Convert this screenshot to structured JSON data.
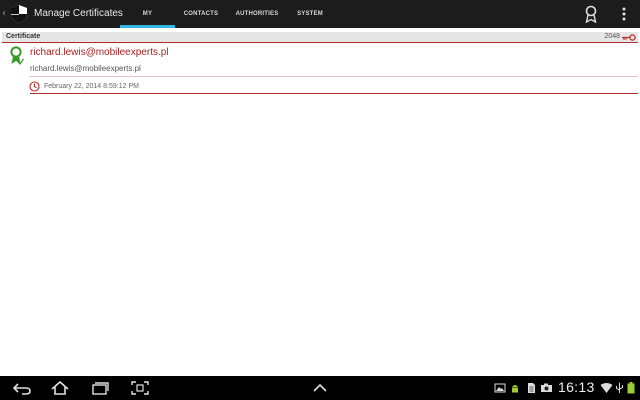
{
  "app": {
    "title": "Manage Certificates",
    "up_glyph": "‹",
    "icon": "shield-icon"
  },
  "tabs": [
    {
      "label": "MY",
      "active": true
    },
    {
      "label": "CONTACTS",
      "active": false
    },
    {
      "label": "AUTHORITIES",
      "active": false
    },
    {
      "label": "SYSTEM",
      "active": false
    }
  ],
  "actions": [
    {
      "icon": "award-icon"
    },
    {
      "icon": "overflow-menu-icon"
    }
  ],
  "section": {
    "label": "Certificate",
    "count": "2048",
    "icon": "key-icon"
  },
  "certificates": [
    {
      "name": "richard.lewis@mobileexperts.pl",
      "subject": "richard.lewis@mobileexperts.pl",
      "date": "February 22, 2014 8:59:12 PM",
      "icon": "certificate-valid-icon"
    }
  ],
  "system_bar": {
    "time": "16:13",
    "nav_icons": [
      "back-icon",
      "home-icon",
      "recent-apps-icon",
      "screenshot-icon",
      "up-arrow-icon"
    ],
    "status_icons": [
      "gallery-icon",
      "android-icon",
      "document-icon",
      "camera-icon",
      "wifi-icon",
      "usb-icon",
      "battery-icon"
    ]
  },
  "colors": {
    "accent": "#33b5e5",
    "cert_red": "#b02020",
    "action_bar": "#1c1c1c",
    "cert_green": "#3a9a2a"
  }
}
